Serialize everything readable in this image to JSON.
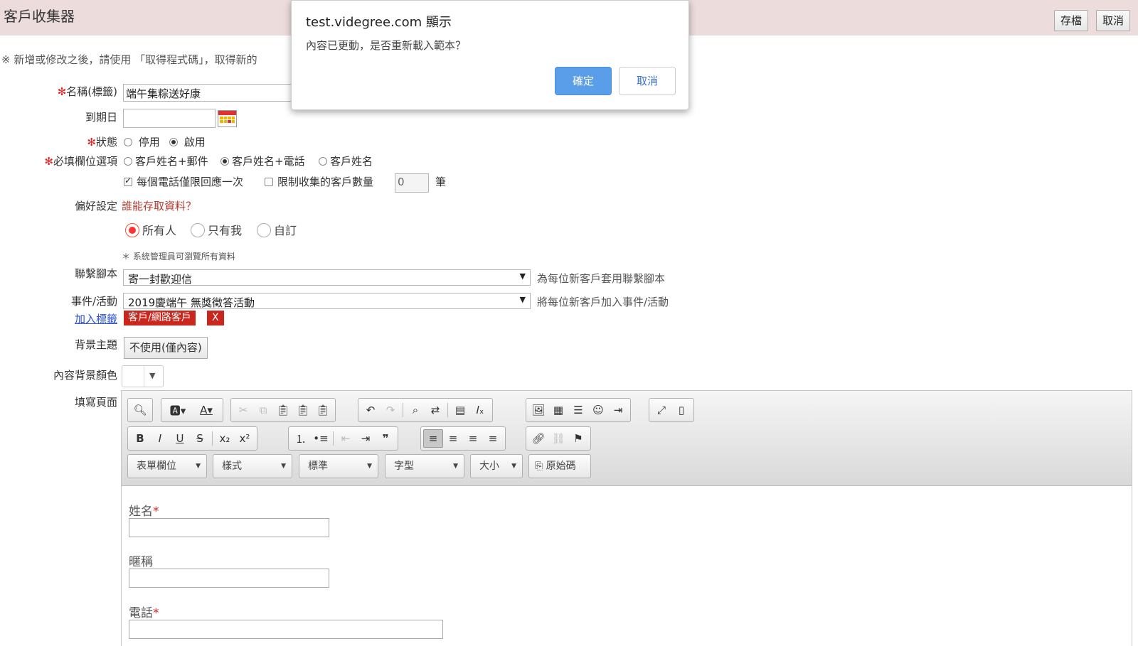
{
  "header": {
    "title": "客戶收集器",
    "save_label": "存檔",
    "cancel_label": "取消"
  },
  "notice": "※ 新增或修改之後，請使用 「取得程式碼」，取得新的",
  "form": {
    "name_label": "名稱(標籤)",
    "name_value": "端午集粽送好康",
    "expiry_label": "到期日",
    "expiry_value": "",
    "status_label": "狀態",
    "status_options": [
      "停用",
      "啟用"
    ],
    "required_label": "必填欄位選項",
    "required_options": [
      "客戶姓名+郵件",
      "客戶姓名+電話",
      "客戶姓名"
    ],
    "once_label": "每個電話僅限回應一次",
    "limit_label": "限制收集的客戶數量",
    "limit_value": "0",
    "limit_unit": "筆",
    "pref_label": "偏好設定",
    "pref_link": "誰能存取資料？",
    "access_options": [
      "所有人",
      "只有我",
      "自訂"
    ],
    "admin_note": "＊ 系統管理員可瀏覽所有資料",
    "script_label": "聯繫腳本",
    "script_value": "寄一封歡迎信",
    "script_hint": "為每位新客戶套用聯繫腳本",
    "event_label": "事件/活動",
    "event_value": "2019慶端午 無獎徵答活動",
    "event_hint": "將每位新客戶加入事件/活動",
    "add_tag_link": "加入標籤",
    "tag": "客戶/網路客戶",
    "tag_remove": "X",
    "theme_label": "背景主題",
    "theme_value": "不使用(僅內容)",
    "bgcolor_label": "內容背景顏色",
    "page_label": "填寫頁面"
  },
  "editor": {
    "combos": [
      "表單欄位",
      "樣式",
      "標準",
      "字型",
      "大小"
    ],
    "source_label": "原始碼",
    "fields": [
      {
        "label": "姓名",
        "required": "*"
      },
      {
        "label": "暱稱",
        "required": ""
      },
      {
        "label": "電話",
        "required": "*"
      }
    ]
  },
  "dialog": {
    "title": "test.videgree.com 顯示",
    "message": "內容已更動，是否重新載入範本？",
    "ok_label": "確定",
    "cancel_label": "取消"
  }
}
